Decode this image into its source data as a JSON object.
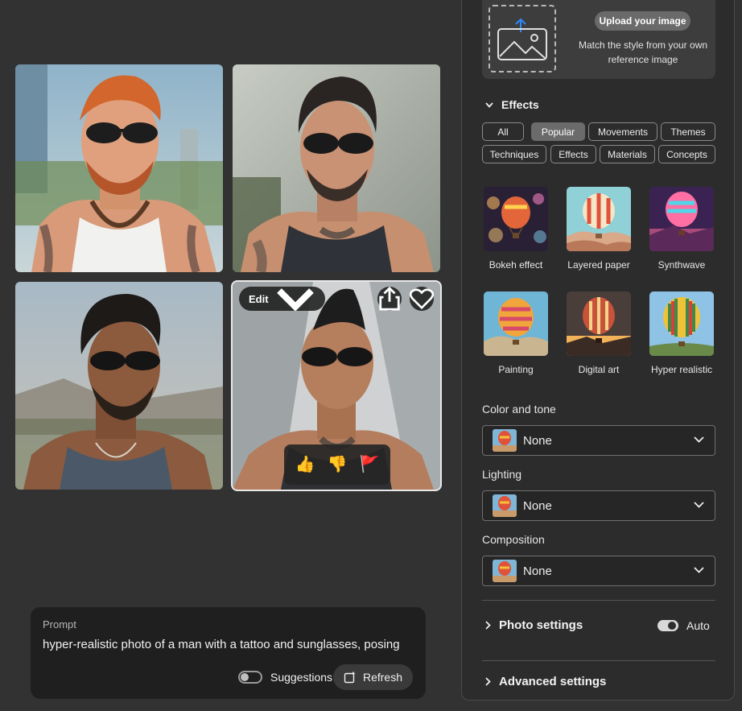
{
  "gallery": {
    "edit_label": "Edit",
    "feedback": {
      "like": "👍",
      "dislike": "👎",
      "flag": "🚩"
    }
  },
  "prompt": {
    "label": "Prompt",
    "text": "hyper-realistic photo of a man with a tattoo and sunglasses, posing",
    "suggestions_label": "Suggestions",
    "suggestions_on": false,
    "refresh_label": "Refresh"
  },
  "upload": {
    "button_label": "Upload your image",
    "description": "Match the style from your own reference image"
  },
  "effects": {
    "title": "Effects",
    "chips": [
      "All",
      "Popular",
      "Movements",
      "Themes",
      "Techniques",
      "Effects",
      "Materials",
      "Concepts"
    ],
    "active_chip": "Popular",
    "items": [
      {
        "label": "Bokeh effect"
      },
      {
        "label": "Layered paper"
      },
      {
        "label": "Synthwave"
      },
      {
        "label": "Painting"
      },
      {
        "label": "Digital art"
      },
      {
        "label": "Hyper realistic"
      }
    ]
  },
  "color_tone": {
    "label": "Color and tone",
    "value": "None"
  },
  "lighting": {
    "label": "Lighting",
    "value": "None"
  },
  "composition": {
    "label": "Composition",
    "value": "None"
  },
  "photo_settings": {
    "label": "Photo settings",
    "auto_label": "Auto",
    "auto_on": true
  },
  "advanced_settings": {
    "label": "Advanced settings"
  },
  "colors": {
    "background": "#323232",
    "panel": "#2c2c2c",
    "accent_flag": "#d7352e"
  }
}
